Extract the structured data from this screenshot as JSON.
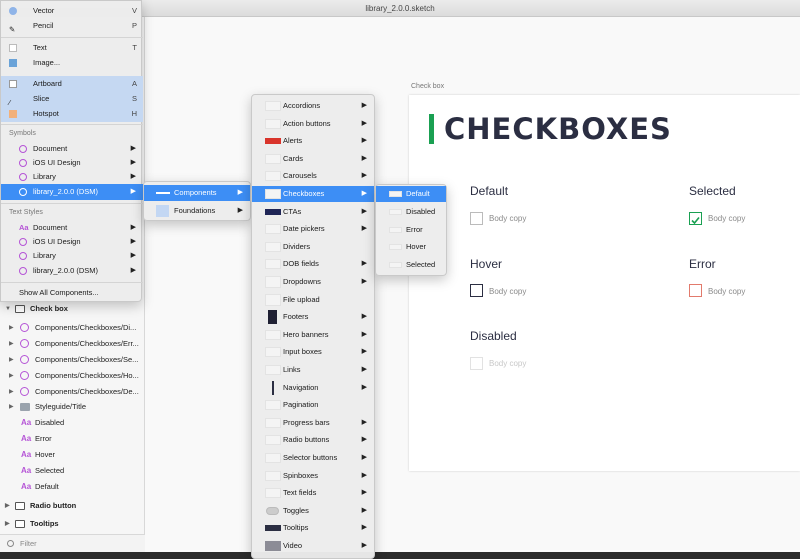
{
  "window": {
    "title": "library_2.0.0.sketch"
  },
  "insert_menu": {
    "items": [
      {
        "label": "Vector",
        "key": "V"
      },
      {
        "label": "Pencil",
        "key": "P"
      },
      {
        "label": "Text",
        "key": "T"
      },
      {
        "label": "Image...",
        "key": ""
      },
      {
        "label": "Artboard",
        "key": "A"
      },
      {
        "label": "Slice",
        "key": "S"
      },
      {
        "label": "Hotspot",
        "key": "H"
      }
    ],
    "symbols_header": "Symbols",
    "symbols": [
      {
        "label": "Document"
      },
      {
        "label": "iOS UI Design"
      },
      {
        "label": "Library"
      },
      {
        "label": "library_2.0.0 (DSM)"
      }
    ],
    "text_styles_header": "Text Styles",
    "text_styles": [
      {
        "label": "Document"
      },
      {
        "label": "iOS UI Design"
      },
      {
        "label": "Library"
      },
      {
        "label": "library_2.0.0 (DSM)"
      }
    ],
    "show_all": "Show All Components..."
  },
  "library_submenu": {
    "items": [
      {
        "label": "Components"
      },
      {
        "label": "Foundations"
      }
    ]
  },
  "components_submenu": {
    "items": [
      {
        "label": "Accordions"
      },
      {
        "label": "Action buttons"
      },
      {
        "label": "Alerts"
      },
      {
        "label": "Cards"
      },
      {
        "label": "Carousels"
      },
      {
        "label": "Checkboxes"
      },
      {
        "label": "CTAs"
      },
      {
        "label": "Date pickers"
      },
      {
        "label": "Dividers"
      },
      {
        "label": "DOB fields"
      },
      {
        "label": "Dropdowns"
      },
      {
        "label": "File upload"
      },
      {
        "label": "Footers"
      },
      {
        "label": "Hero banners"
      },
      {
        "label": "Input boxes"
      },
      {
        "label": "Links"
      },
      {
        "label": "Navigation"
      },
      {
        "label": "Pagination"
      },
      {
        "label": "Progress bars"
      },
      {
        "label": "Radio buttons"
      },
      {
        "label": "Selector buttons"
      },
      {
        "label": "Spinboxes"
      },
      {
        "label": "Text fields"
      },
      {
        "label": "Toggles"
      },
      {
        "label": "Tooltips"
      },
      {
        "label": "Video"
      }
    ]
  },
  "checkboxes_submenu": {
    "items": [
      {
        "label": "Default"
      },
      {
        "label": "Disabled"
      },
      {
        "label": "Error"
      },
      {
        "label": "Hover"
      },
      {
        "label": "Selected"
      }
    ]
  },
  "layers": {
    "group": "Check box",
    "items": [
      {
        "label": "Components/Checkboxes/Di..."
      },
      {
        "label": "Components/Checkboxes/Err..."
      },
      {
        "label": "Components/Checkboxes/Se..."
      },
      {
        "label": "Components/Checkboxes/Ho..."
      },
      {
        "label": "Components/Checkboxes/De..."
      },
      {
        "label": "Styleguide/Title"
      },
      {
        "label": "Disabled"
      },
      {
        "label": "Error"
      },
      {
        "label": "Hover"
      },
      {
        "label": "Selected"
      },
      {
        "label": "Default"
      }
    ],
    "radio": "Radio button",
    "tooltips": "Tooltips",
    "filter_placeholder": "Filter"
  },
  "artboard": {
    "label": "Check box",
    "title": "CHECKBOXES",
    "states": [
      {
        "title": "Default",
        "body": "Body copy"
      },
      {
        "title": "Selected",
        "body": "Body copy"
      },
      {
        "title": "Hover",
        "body": "Body copy"
      },
      {
        "title": "Error",
        "body": "Body copy"
      },
      {
        "title": "Disabled",
        "body": "Body copy"
      }
    ]
  },
  "colors": {
    "accent_green": "#1aa052",
    "menu_highlight": "#3d8ef5",
    "error": "#e27a6c",
    "title": "#2b2e42"
  }
}
